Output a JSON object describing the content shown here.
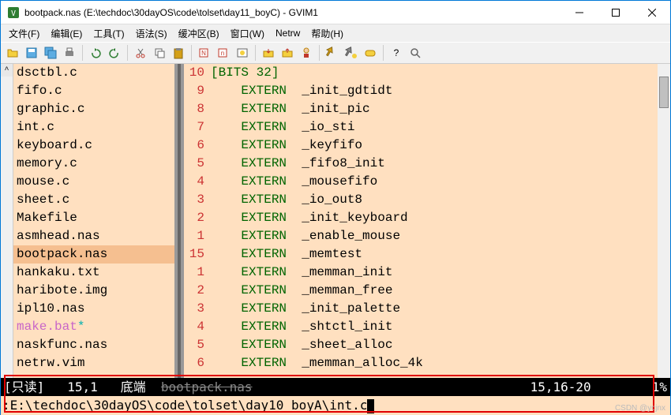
{
  "window": {
    "title": "bootpack.nas (E:\\techdoc\\30dayOS\\code\\tolset\\day11_boyC) - GVIM1"
  },
  "menu": {
    "file": "文件(F)",
    "edit": "编辑(E)",
    "tools": "工具(T)",
    "syntax": "语法(S)",
    "buffers": "缓冲区(B)",
    "window": "窗口(W)",
    "netrw": "Netrw",
    "help": "帮助(H)"
  },
  "files": [
    {
      "name": "dsctbl.c"
    },
    {
      "name": "fifo.c"
    },
    {
      "name": "graphic.c"
    },
    {
      "name": "int.c"
    },
    {
      "name": "keyboard.c"
    },
    {
      "name": "memory.c"
    },
    {
      "name": "mouse.c"
    },
    {
      "name": "sheet.c"
    },
    {
      "name": "Makefile"
    },
    {
      "name": "asmhead.nas"
    },
    {
      "name": "bootpack.nas",
      "sel": true
    },
    {
      "name": "hankaku.txt"
    },
    {
      "name": "haribote.img"
    },
    {
      "name": "ipl10.nas"
    },
    {
      "name": "make.bat",
      "mod": true
    },
    {
      "name": "naskfunc.nas"
    },
    {
      "name": "netrw.vim"
    }
  ],
  "code": [
    {
      "n": "10",
      "a": "[BITS 32]",
      "b": ""
    },
    {
      "n": "9",
      "a": "    EXTERN  ",
      "b": "_init_gdtidt"
    },
    {
      "n": "8",
      "a": "    EXTERN  ",
      "b": "_init_pic"
    },
    {
      "n": "7",
      "a": "    EXTERN  ",
      "b": "_io_sti"
    },
    {
      "n": "6",
      "a": "    EXTERN  ",
      "b": "_keyfifo"
    },
    {
      "n": "5",
      "a": "    EXTERN  ",
      "b": "_fifo8_init"
    },
    {
      "n": "4",
      "a": "    EXTERN  ",
      "b": "_mousefifo"
    },
    {
      "n": "3",
      "a": "    EXTERN  ",
      "b": "_io_out8"
    },
    {
      "n": "2",
      "a": "    EXTERN  ",
      "b": "_init_keyboard"
    },
    {
      "n": "1",
      "a": "    EXTERN  ",
      "b": "_enable_mouse"
    },
    {
      "n": "15",
      "a": "    EXTERN  ",
      "b": "_memtest",
      "hl": true
    },
    {
      "n": "1",
      "a": "    EXTERN  ",
      "b": "_memman_init"
    },
    {
      "n": "2",
      "a": "    EXTERN  ",
      "b": "_memman_free"
    },
    {
      "n": "3",
      "a": "    EXTERN  ",
      "b": "_init_palette"
    },
    {
      "n": "4",
      "a": "    EXTERN  ",
      "b": "_shtctl_init"
    },
    {
      "n": "5",
      "a": "    EXTERN  ",
      "b": "_sheet_alloc"
    },
    {
      "n": "6",
      "a": "    EXTERN  ",
      "b": "_memman_alloc_4k"
    }
  ],
  "status": {
    "readonly": "[只读]",
    "lpos": "15,1",
    "lend": "底端",
    "struck": "bootpack.nas",
    "rpos": "15,16-20",
    "pct": "1%"
  },
  "cmd": ":E:\\techdoc\\30dayOS\\code\\tolset\\day10_boyA\\int.c",
  "watermark": "CSDN @ycjnx"
}
